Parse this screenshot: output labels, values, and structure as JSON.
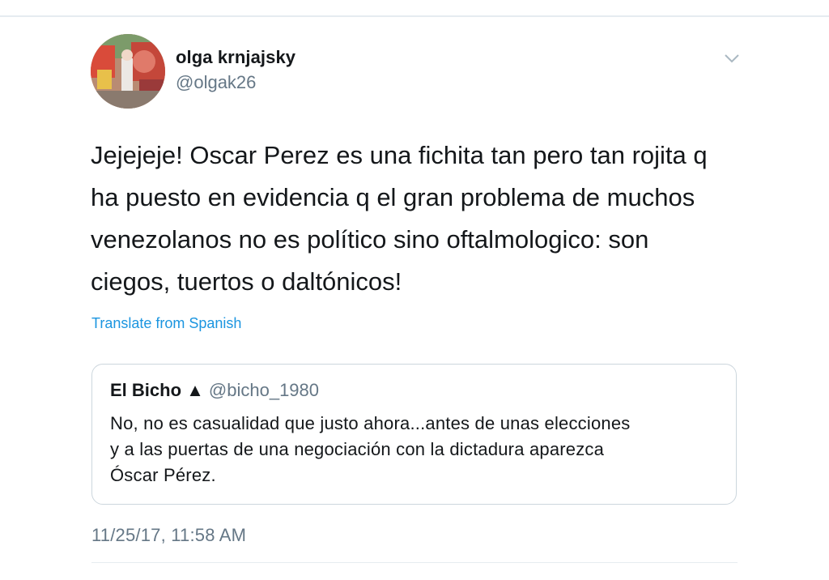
{
  "tweet": {
    "display_name": "olga krnjajsky",
    "handle": "@olgak26",
    "avatar": "avatar-graffiti-photo",
    "menu_icon": "chevron-down-icon",
    "text": "Jejejeje! Oscar Perez es una fichita tan pero tan rojita q\nha puesto en evidencia q el gran problema de muchos\nvenezolanos no es político sino oftalmologico: son\nciegos, tuertos o daltónicos!",
    "translate_label": "Translate from Spanish",
    "timestamp": "11/25/17, 11:58 AM"
  },
  "quote": {
    "display_name": "El Bicho ▲",
    "handle": "@bicho_1980",
    "text": "No, no es casualidad que justo ahora...antes de unas elecciones\ny a las puertas de una negociación con la dictadura aparezca\nÓscar Pérez."
  },
  "colors": {
    "primary_text": "#14171a",
    "secondary_text": "#657786",
    "link": "#1b95e0",
    "border": "#ccd6dd"
  }
}
